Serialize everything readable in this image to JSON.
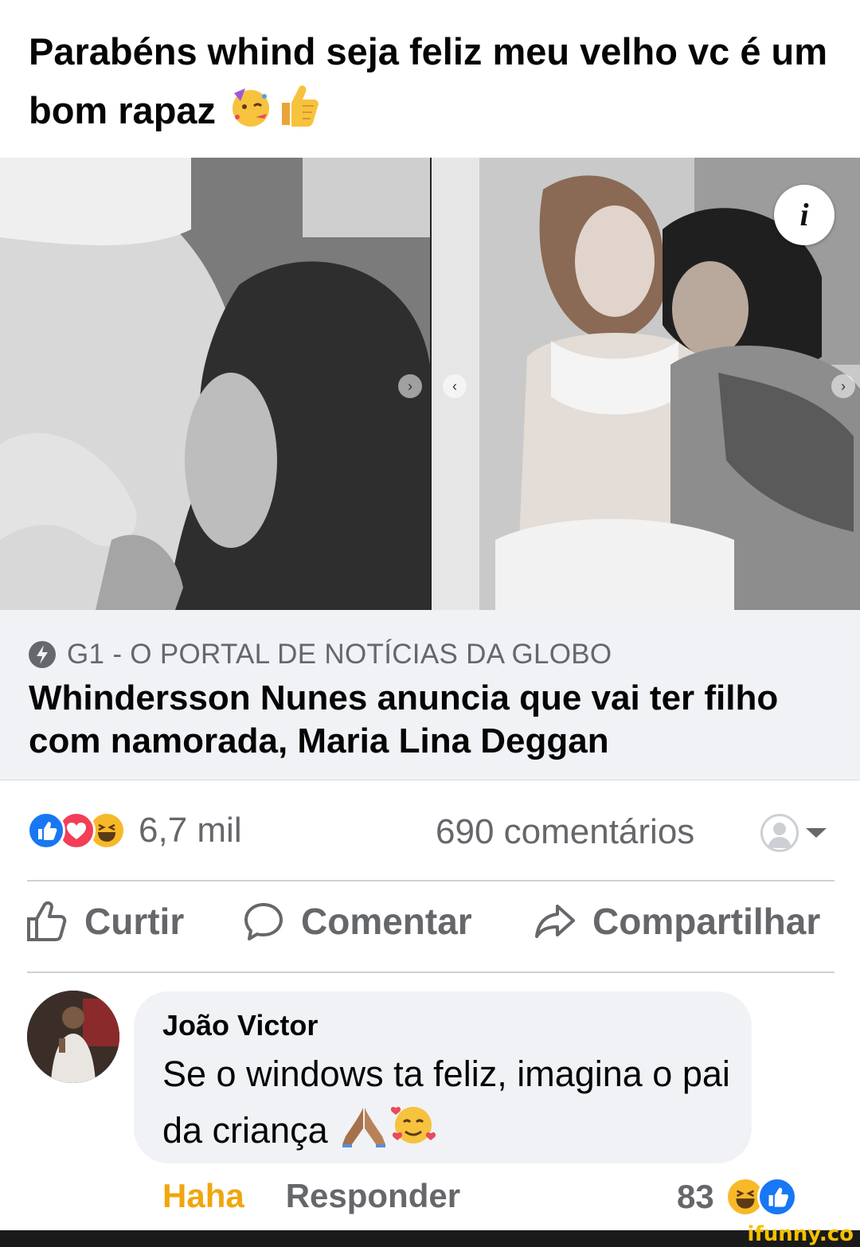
{
  "post": {
    "text": "Parabéns whind seja feliz meu velho vc é um bom rapaz",
    "emojis": [
      "partying-face",
      "thumbs-up"
    ]
  },
  "media": {
    "info_label": "i"
  },
  "link_card": {
    "source": "G1 - O PORTAL DE NOTÍCIAS DA GLOBO",
    "title": "Whindersson Nunes anuncia que vai ter filho com namorada, Maria Lina Deggan"
  },
  "stats": {
    "reactions": [
      "like",
      "love",
      "haha"
    ],
    "reaction_count": "6,7 mil",
    "comments_count": "690 comentários"
  },
  "actions": {
    "like_label": "Curtir",
    "comment_label": "Comentar",
    "share_label": "Compartilhar"
  },
  "comment": {
    "author": "João Victor",
    "text": "Se o windows ta feliz, imagina o pai da criança",
    "emojis": [
      "folded-hands",
      "smiling-face-with-hearts"
    ],
    "haha_label": "Haha",
    "reply_label": "Responder",
    "reaction_count": "83",
    "reactions": [
      "haha",
      "like"
    ]
  },
  "watermark": "ifunny.co",
  "colors": {
    "facebook_blue": "#1877f2",
    "love_red": "#f33e58",
    "haha_yellow": "#f7b928",
    "secondary_text": "#65676b",
    "card_bg": "#f0f2f5"
  }
}
